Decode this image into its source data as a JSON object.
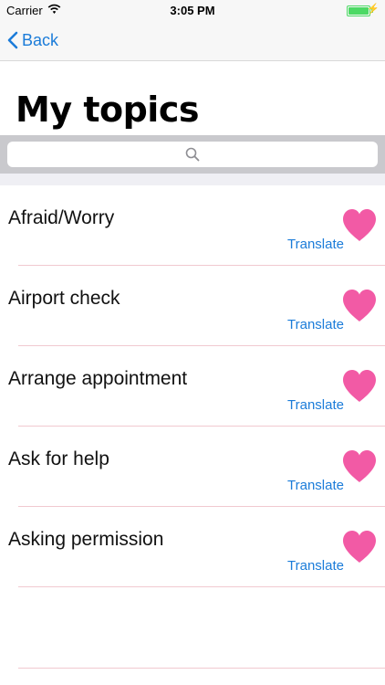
{
  "status_bar": {
    "carrier": "Carrier",
    "time": "3:05 PM"
  },
  "nav": {
    "back_label": "Back"
  },
  "page": {
    "title": "My topics"
  },
  "search": {
    "placeholder": ""
  },
  "topics": [
    {
      "title": "Afraid/Worry",
      "action": "Translate"
    },
    {
      "title": "Airport check",
      "action": "Translate"
    },
    {
      "title": "Arrange appointment",
      "action": "Translate"
    },
    {
      "title": "Ask for help",
      "action": "Translate"
    },
    {
      "title": "Asking permission",
      "action": "Translate"
    }
  ],
  "colors": {
    "accent": "#1b7cd9",
    "heart": "#f25aa5",
    "separator": "#f1c9d0",
    "battery": "#4cd964"
  },
  "icons": [
    "wifi-icon",
    "battery-icon",
    "chevron-left-icon",
    "search-icon",
    "heart-icon"
  ]
}
